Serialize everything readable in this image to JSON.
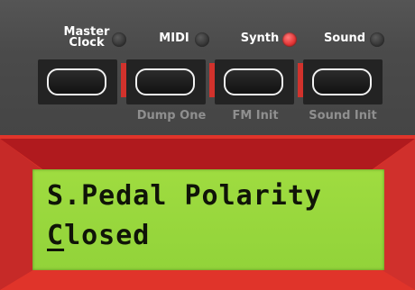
{
  "buttons": [
    {
      "id": "master-clock",
      "label_line1": "Master",
      "label_line2": "Clock",
      "led_on": false,
      "sub_label": ""
    },
    {
      "id": "midi",
      "label_line1": "MIDI",
      "label_line2": "",
      "led_on": false,
      "sub_label": "Dump One"
    },
    {
      "id": "synth",
      "label_line1": "Synth",
      "label_line2": "",
      "led_on": true,
      "sub_label": "FM Init"
    },
    {
      "id": "sound",
      "label_line1": "Sound",
      "label_line2": "",
      "led_on": false,
      "sub_label": "Sound Init"
    }
  ],
  "display": {
    "line1": "S.Pedal Polarity",
    "line2_cursor_char": "C",
    "line2_rest": "losed"
  },
  "colors": {
    "panel_red": "#e0342a",
    "lcd_green": "#9fdc40",
    "led_on": "#e53636"
  }
}
